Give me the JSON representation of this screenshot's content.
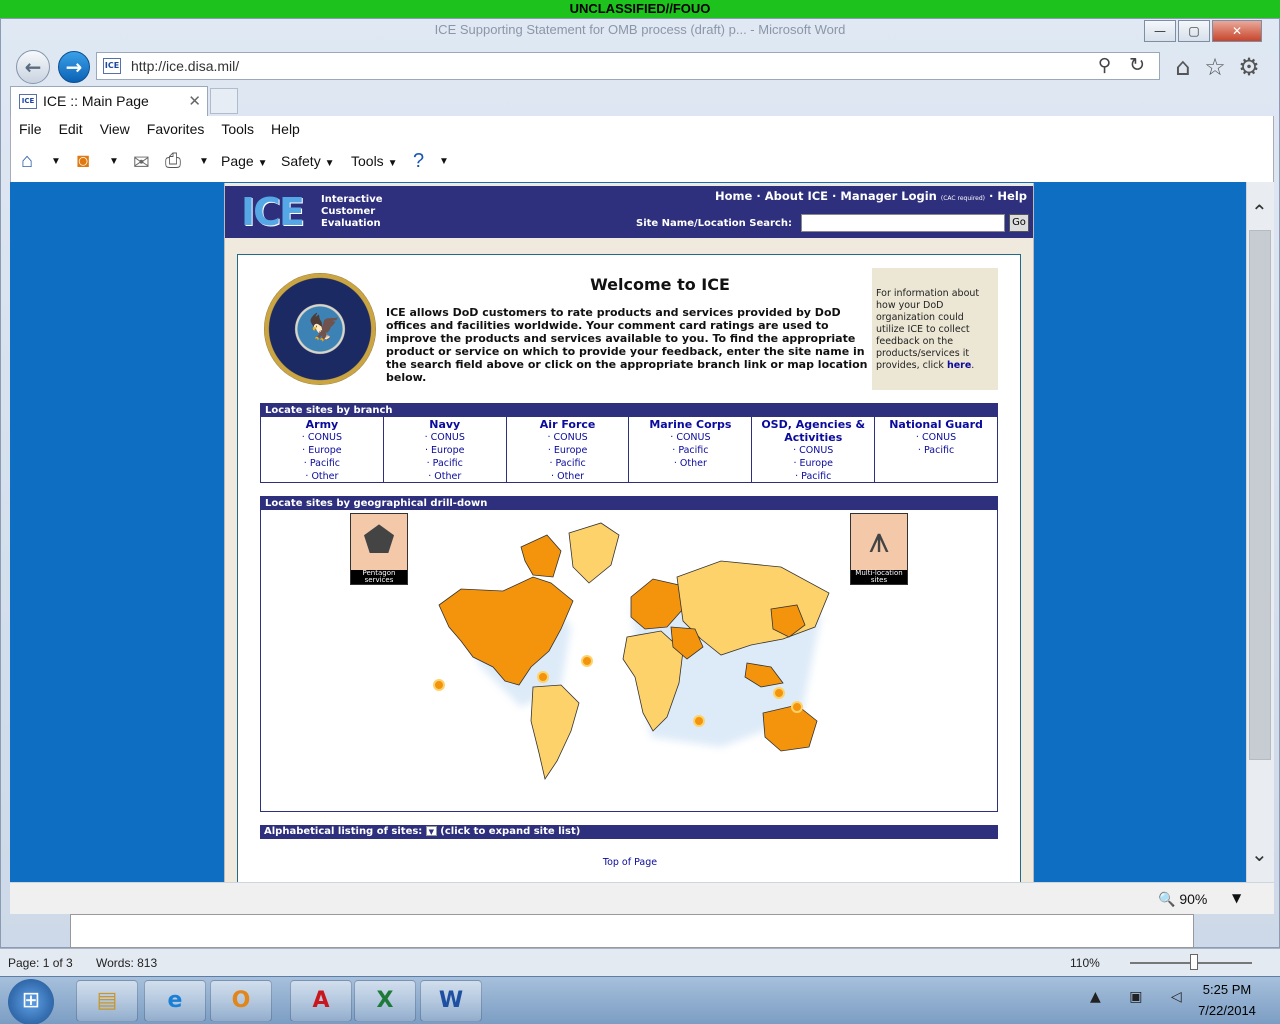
{
  "classification": "UNCLASSIFIED//FOUO",
  "window": {
    "title": "ICE Supporting Statement for OMB process (draft) p... - Microsoft Word",
    "min": "—",
    "max": "▢",
    "close": "✕"
  },
  "browser": {
    "url": "http://ice.disa.mil/",
    "tab_title": "ICE :: Main Page",
    "menu": [
      "File",
      "Edit",
      "View",
      "Favorites",
      "Tools",
      "Help"
    ],
    "cmd": {
      "page": "Page",
      "safety": "Safety",
      "tools": "Tools"
    },
    "zoom": "90%"
  },
  "page": {
    "logo": "ICE",
    "logo_sub": [
      "Interactive",
      "Customer",
      "Evaluation"
    ],
    "nav": {
      "home": "Home",
      "about": "About ICE",
      "login": "Manager Login",
      "login_note": "(CAC required)",
      "help": "Help"
    },
    "search_label": "Site Name/Location Search:",
    "search_go": "Go",
    "welcome_title": "Welcome to ICE",
    "intro": "ICE allows DoD customers to rate products and services provided by DoD offices and facilities worldwide. Your comment card ratings are used to improve the products and services available to you. To find the appropriate product or service on which to provide your feedback, enter the site name in the search field above or click on the appropriate branch link or map location below.",
    "info_text": "For information about how your DoD organization could utilize ICE to collect feedback on the products/services it provides, click",
    "info_link": "here",
    "branch_header": "Locate sites by branch",
    "branches": [
      {
        "name": "Army",
        "links": [
          "CONUS",
          "Europe",
          "Pacific",
          "Other"
        ]
      },
      {
        "name": "Navy",
        "links": [
          "CONUS",
          "Europe",
          "Pacific",
          "Other"
        ]
      },
      {
        "name": "Air Force",
        "links": [
          "CONUS",
          "Europe",
          "Pacific",
          "Other"
        ]
      },
      {
        "name": "Marine Corps",
        "links": [
          "CONUS",
          "Pacific",
          "Other"
        ]
      },
      {
        "name": "OSD, Agencies & Activities",
        "links": [
          "CONUS",
          "Europe",
          "Pacific"
        ]
      },
      {
        "name": "National Guard",
        "links": [
          "CONUS",
          "Pacific"
        ]
      }
    ],
    "geo_header": "Locate sites by geographical drill-down",
    "pentagon_caption": "Pentagon services",
    "multiloc_caption": "Multi-location sites",
    "alpha_label": "Alphabetical listing of sites:",
    "alpha_hint": "(click to expand site list)",
    "top_of_page": "Top of Page",
    "colors": {
      "header": "#2e2f7d",
      "map_active": "#f4940c",
      "map_land": "#fed26b"
    }
  },
  "word": {
    "page": "Page: 1 of 3",
    "words": "Words: 813",
    "zoom": "110%"
  },
  "taskbar": {
    "time": "5:25 PM",
    "date": "7/22/2014"
  }
}
